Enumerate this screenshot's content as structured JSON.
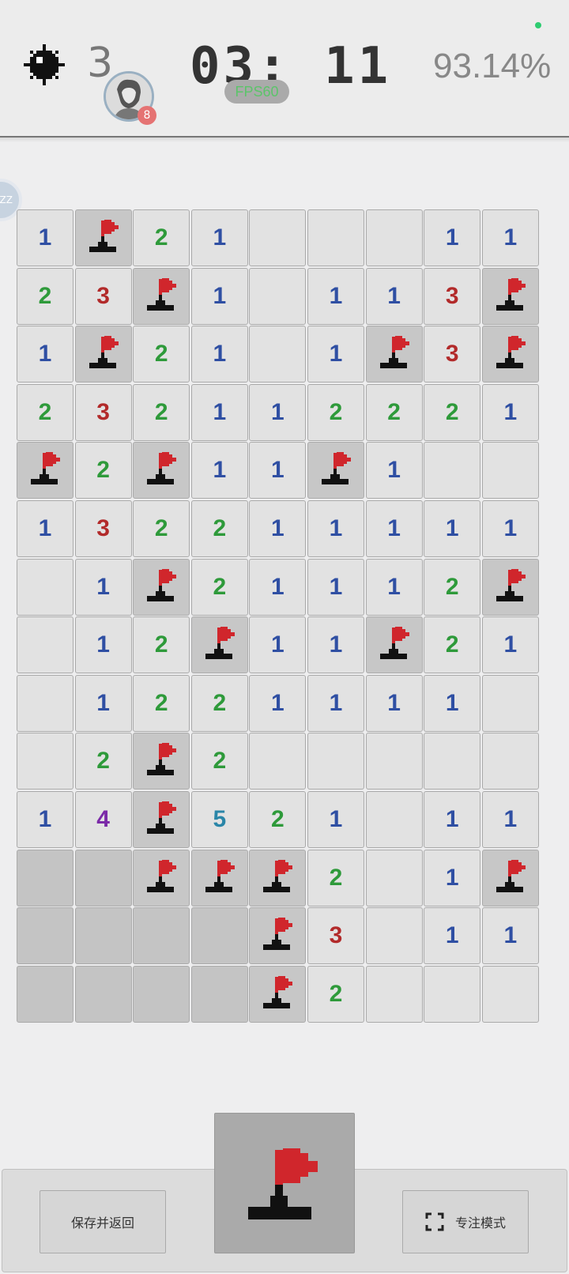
{
  "header": {
    "mines_remaining": "3",
    "timer": "03: 11",
    "fps": "FPS60",
    "progress_percent": "93.14%",
    "avatar_badge": "8"
  },
  "side_handle": {
    "label": "ZZ"
  },
  "board": {
    "columns": 9,
    "rows": 14,
    "cells": [
      [
        "1",
        "F",
        "2",
        "1",
        "",
        "",
        "",
        "1",
        "1"
      ],
      [
        "2",
        "3",
        "F",
        "1",
        "",
        "1",
        "1",
        "3",
        "F"
      ],
      [
        "1",
        "F",
        "2",
        "1",
        "",
        "1",
        "F",
        "3",
        "F"
      ],
      [
        "2",
        "3",
        "2",
        "1",
        "1",
        "2",
        "2",
        "2",
        "1"
      ],
      [
        "F",
        "2",
        "F",
        "1",
        "1",
        "F",
        "1",
        "",
        ""
      ],
      [
        "1",
        "3",
        "2",
        "2",
        "1",
        "1",
        "1",
        "1",
        "1"
      ],
      [
        "",
        "1",
        "F",
        "2",
        "1",
        "1",
        "1",
        "2",
        "F"
      ],
      [
        "",
        "1",
        "2",
        "F",
        "1",
        "1",
        "F",
        "2",
        "1"
      ],
      [
        "",
        "1",
        "2",
        "2",
        "1",
        "1",
        "1",
        "1",
        ""
      ],
      [
        "",
        "2",
        "F",
        "2",
        "",
        "",
        "",
        "",
        ""
      ],
      [
        "1",
        "4",
        "F",
        "5",
        "2",
        "1",
        "",
        "1",
        "1"
      ],
      [
        "H",
        "H",
        "F",
        "F",
        "F",
        "2",
        "",
        "1",
        "F"
      ],
      [
        "H",
        "H",
        "H",
        "H",
        "F",
        "3",
        "",
        "1",
        "1"
      ],
      [
        "H",
        "H",
        "H",
        "H",
        "F",
        "2",
        "",
        "",
        ""
      ]
    ],
    "number_colors": {
      "1": "#2f4fa3",
      "2": "#2e9a3a",
      "3": "#b22a2a",
      "4": "#7b2aa8",
      "5": "#2a86a8"
    }
  },
  "buttons": {
    "save_and_return": "保存并返回",
    "focus_mode": "专注模式"
  },
  "colors": {
    "flag_red": "#d0262c",
    "flag_base": "#111111",
    "fps_text": "#5cc46a",
    "status_dot": "#2ecc71"
  }
}
